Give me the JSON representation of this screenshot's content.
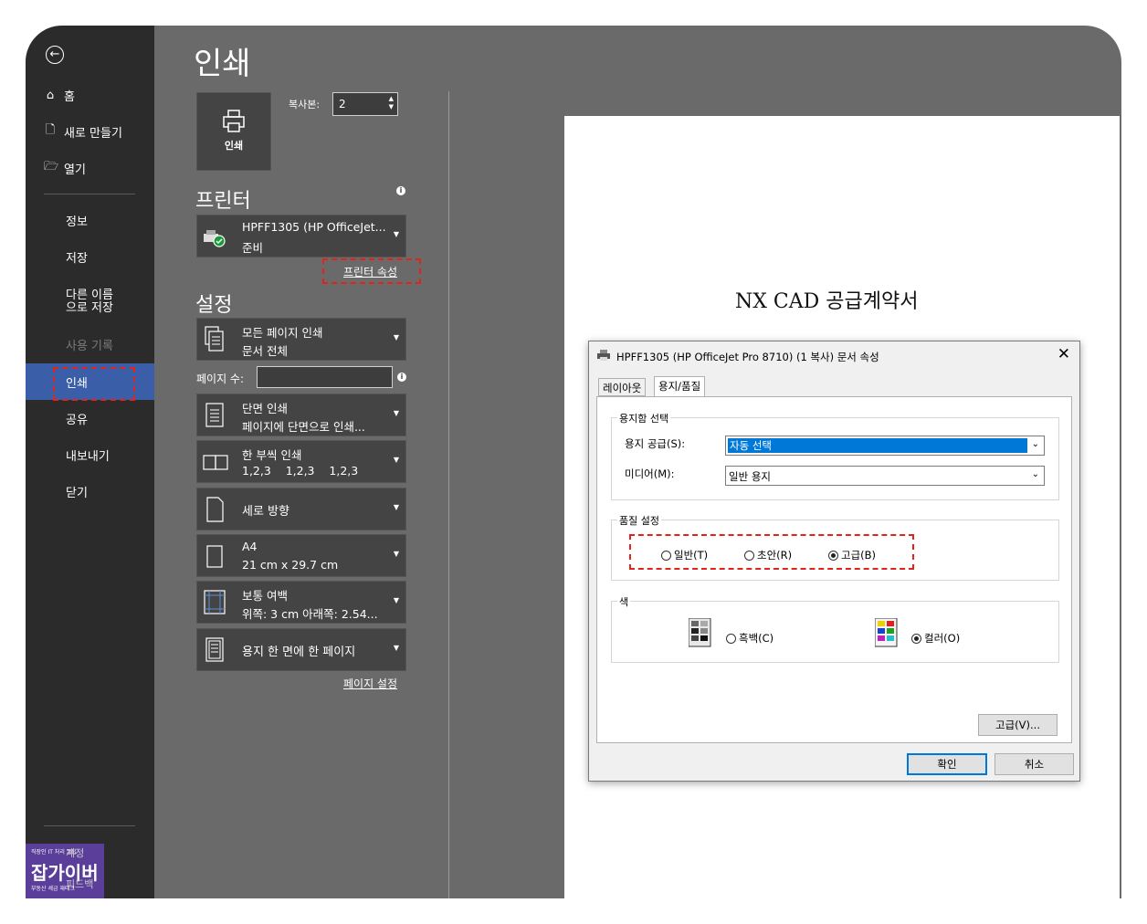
{
  "sidebar": {
    "items": [
      {
        "label": "홈",
        "icon": "home-icon"
      },
      {
        "label": "새로 만들기",
        "icon": "new-document-icon"
      },
      {
        "label": "열기",
        "icon": "open-folder-icon"
      },
      {
        "label": "정보"
      },
      {
        "label": "저장"
      },
      {
        "label": "다른 이름으로 저장"
      },
      {
        "label": "사용 기록"
      },
      {
        "label": "인쇄"
      },
      {
        "label": "공유"
      },
      {
        "label": "내보내기"
      },
      {
        "label": "닫기"
      }
    ],
    "bottom_partial": "계정",
    "watermark": {
      "top": "직장인 IT 처리 꿀팁",
      "main": "잡가이버",
      "bottom": "부동산 세금 재테크",
      "ghost": "피드백"
    }
  },
  "print": {
    "title": "인쇄",
    "button_label": "인쇄",
    "copies_label": "복사본:",
    "copies_value": "2"
  },
  "printer": {
    "section_title": "프린터",
    "name": "HPFF1305 (HP OfficeJet...",
    "status": "준비",
    "properties_link": "프린터 속성"
  },
  "settings": {
    "section_title": "설정",
    "pages_label": "페이지 수:",
    "pages_value": "",
    "options": [
      {
        "l1": "모든 페이지 인쇄",
        "l2": "문서 전체"
      },
      {
        "l1": "단면 인쇄",
        "l2": "페이지에 단면으로 인쇄..."
      },
      {
        "l1": "한 부씩 인쇄",
        "l2": "1,2,3    1,2,3    1,2,3"
      },
      {
        "l1": "세로 방향"
      },
      {
        "l1": "A4",
        "l2": "21 cm x 29.7 cm"
      },
      {
        "l1": "보통 여백",
        "l2": "위쪽: 3 cm 아래쪽: 2.54..."
      },
      {
        "l1": "용지 한 면에 한 페이지"
      }
    ],
    "page_setup_link": "페이지 설정"
  },
  "preview": {
    "doc_title": "NX CAD  공급계약서"
  },
  "dialog": {
    "title": "HPFF1305 (HP OfficeJet Pro 8710) (1 복사) 문서 속성",
    "tabs": [
      "레이아웃",
      "용지/품질"
    ],
    "tray_group": "용지함 선택",
    "paper_source_label": "용지 공급(S):",
    "paper_source_value": "자동 선택",
    "media_label": "미디어(M):",
    "media_value": "일반 용지",
    "quality_group": "품질 설정",
    "quality_options": [
      "일반(T)",
      "초안(R)",
      "고급(B)"
    ],
    "quality_selected": "고급(B)",
    "color_group": "색",
    "color_options": [
      "흑백(C)",
      "컬러(O)"
    ],
    "color_selected": "컬러(O)",
    "advanced_button": "고급(V)...",
    "ok_button": "확인",
    "cancel_button": "취소"
  },
  "colors": {
    "sidebar_bg": "#2b2b2b",
    "panel_bg": "#6a6a6a",
    "active_item": "#3b5ea8",
    "highlight_box": "#e2231a",
    "selection": "#0078d7"
  }
}
